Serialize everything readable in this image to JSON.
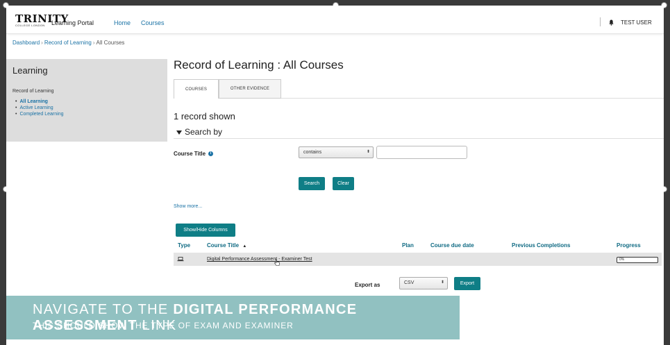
{
  "topnav": {
    "logo_main": "TRINITY",
    "logo_sub": "COLLEGE LONDON",
    "portal_name": "Learning Portal",
    "links": [
      "Home",
      "Courses"
    ],
    "user_name": "TEST USER",
    "bell_icon": "bell-icon"
  },
  "breadcrumb": {
    "items": [
      "Dashboard",
      "Record of Learning",
      "All Courses"
    ],
    "separator": "›"
  },
  "sidebar": {
    "title": "Learning",
    "subtitle": "Record of Learning",
    "items": [
      {
        "label": "All Learning",
        "active": true
      },
      {
        "label": "Active Learning",
        "active": false
      },
      {
        "label": "Completed Learning",
        "active": false
      }
    ]
  },
  "main": {
    "title": "Record of Learning : All Courses",
    "tabs": [
      {
        "label": "COURSES",
        "selected": true
      },
      {
        "label": "OTHER EVIDENCE",
        "selected": false
      }
    ],
    "record_count": "1 record shown",
    "search_by": "Search by",
    "search_toggle_icon": "caret-down-icon"
  },
  "search": {
    "field_label": "Course Title",
    "info_icon": "info-icon",
    "operator": "contains",
    "value": "",
    "search_button": "Search",
    "clear_button": "Clear",
    "show_more": "Show more..."
  },
  "table": {
    "columns_button": "Show/Hide Columns",
    "headers": {
      "type": "Type",
      "course_title": "Course Title",
      "sort_icon": "▲",
      "plan": "Plan",
      "due_date": "Course due date",
      "previous": "Previous Completions",
      "progress": "Progress"
    },
    "rows": [
      {
        "type_icon": "laptop-icon",
        "course_title": "Digital Performance Assessment - Examiner Test",
        "plan": "",
        "due_date": "",
        "previous": "",
        "progress_text": "0%",
        "progress_value": 0
      }
    ]
  },
  "export": {
    "label": "Export as",
    "format": "CSV",
    "button": "Export"
  },
  "caption": {
    "line1_start": "NAVIGATE TO THE ",
    "line1_bold": "DIGITAL PERFORMANCE ASSESSMENT",
    "line1_end": " LINK",
    "line2": "THIS SHOULD SHOW THE TYPE OF EXAM AND EXAMINER"
  },
  "colors": {
    "accent": "#0f7e86",
    "link": "#1a72a5",
    "sidebar_bg": "#dddddd",
    "caption_bg": "#85baba"
  }
}
